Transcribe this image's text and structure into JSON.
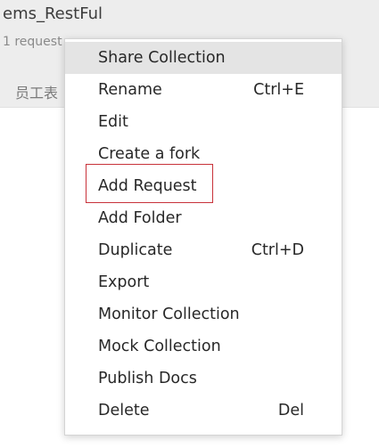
{
  "collection": {
    "name": "ems_RestFul",
    "meta": "1 request",
    "folder": "员工表"
  },
  "menu": {
    "items": [
      {
        "label": "Share Collection",
        "shortcut": "",
        "highlighted": true
      },
      {
        "label": "Rename",
        "shortcut": "Ctrl+E"
      },
      {
        "label": "Edit",
        "shortcut": ""
      },
      {
        "label": "Create a fork",
        "shortcut": ""
      },
      {
        "label": "Add Request",
        "shortcut": ""
      },
      {
        "label": "Add Folder",
        "shortcut": ""
      },
      {
        "label": "Duplicate",
        "shortcut": "Ctrl+D"
      },
      {
        "label": "Export",
        "shortcut": ""
      },
      {
        "label": "Monitor Collection",
        "shortcut": ""
      },
      {
        "label": "Mock Collection",
        "shortcut": ""
      },
      {
        "label": "Publish Docs",
        "shortcut": ""
      },
      {
        "label": "Delete",
        "shortcut": "Del"
      }
    ]
  },
  "colors": {
    "highlight": "#e4e4e4",
    "annotation": "#c8323a"
  }
}
